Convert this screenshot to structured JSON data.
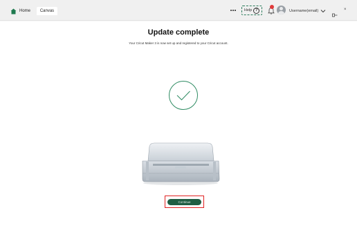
{
  "topbar": {
    "home_label": "Home",
    "canvas_tab": "Canvas",
    "help_label": "Help",
    "help_glyph": "?",
    "user_name": "Username(email)",
    "close_glyph": "×"
  },
  "main": {
    "title": "Update complete",
    "subtitle": "Your Cricut Maker 3 is now set up and registered to your Cricut account.",
    "cta_label": "Continue"
  },
  "colors": {
    "brand_green": "#1f5e43",
    "check_green": "#2e8b62",
    "highlight_red": "#e02020",
    "notification_red": "#e03a3a"
  },
  "icons": [
    "home-icon",
    "more-icon",
    "help-icon",
    "bell-icon",
    "avatar-icon",
    "chevron-down-icon",
    "pin-icon",
    "close-icon",
    "check-icon",
    "cutting-machine-illustration"
  ]
}
